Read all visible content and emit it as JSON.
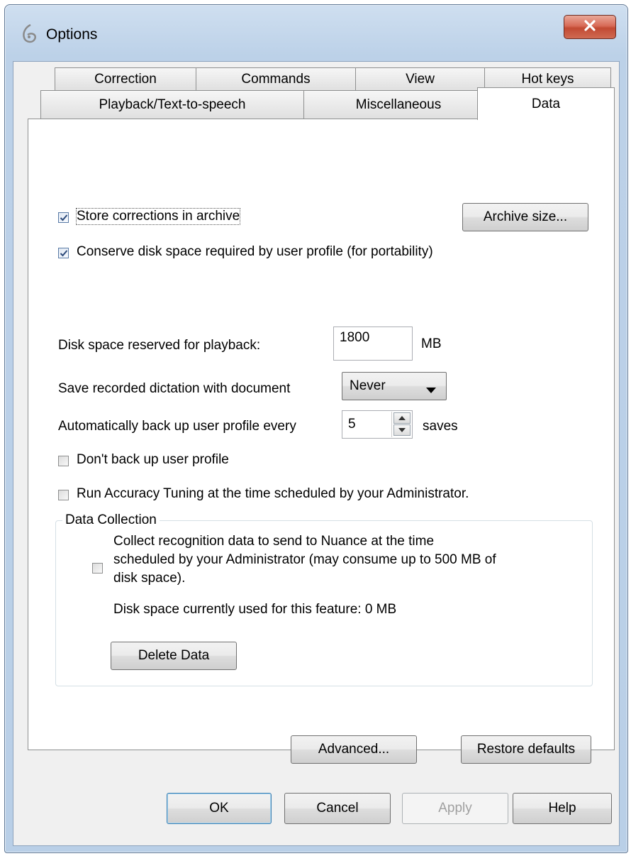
{
  "window": {
    "title": "Options",
    "title_icon": "app-logo-icon",
    "close_icon": "close-icon"
  },
  "tabs": {
    "row1": [
      "Correction",
      "Commands",
      "View",
      "Hot keys"
    ],
    "row2": [
      "Playback/Text-to-speech",
      "Miscellaneous",
      "Data"
    ],
    "active": "Data"
  },
  "data_tab": {
    "store_corrections": {
      "label": "Store corrections in archive",
      "checked": true
    },
    "archive_size_button": "Archive size...",
    "conserve_disk": {
      "label": "Conserve disk space required by user profile (for portability)",
      "checked": true
    },
    "playback_space": {
      "label": "Disk space reserved for playback:",
      "value": "1800",
      "unit": "MB"
    },
    "save_dictation": {
      "label": "Save recorded dictation with document",
      "selected": "Never"
    },
    "auto_backup": {
      "label": "Automatically back up user profile every",
      "value": "5",
      "unit": "saves"
    },
    "dont_backup": {
      "label": "Don't back up user profile",
      "checked": false
    },
    "run_tuning": {
      "label": "Run Accuracy Tuning at the time scheduled by your Administrator.",
      "checked": false
    },
    "data_collection": {
      "title": "Data Collection",
      "collect_line1": "Collect recognition data to send to Nuance at the time",
      "collect_line2": "scheduled by your Administrator (may consume up to 500 MB of",
      "collect_line3": "disk space).",
      "collect_checked": false,
      "disk_used": "Disk space currently used for this feature: 0 MB",
      "delete_button": "Delete Data"
    },
    "advanced_button": "Advanced...",
    "restore_button": "Restore defaults"
  },
  "footer": {
    "ok": "OK",
    "cancel": "Cancel",
    "apply": "Apply",
    "help": "Help"
  }
}
